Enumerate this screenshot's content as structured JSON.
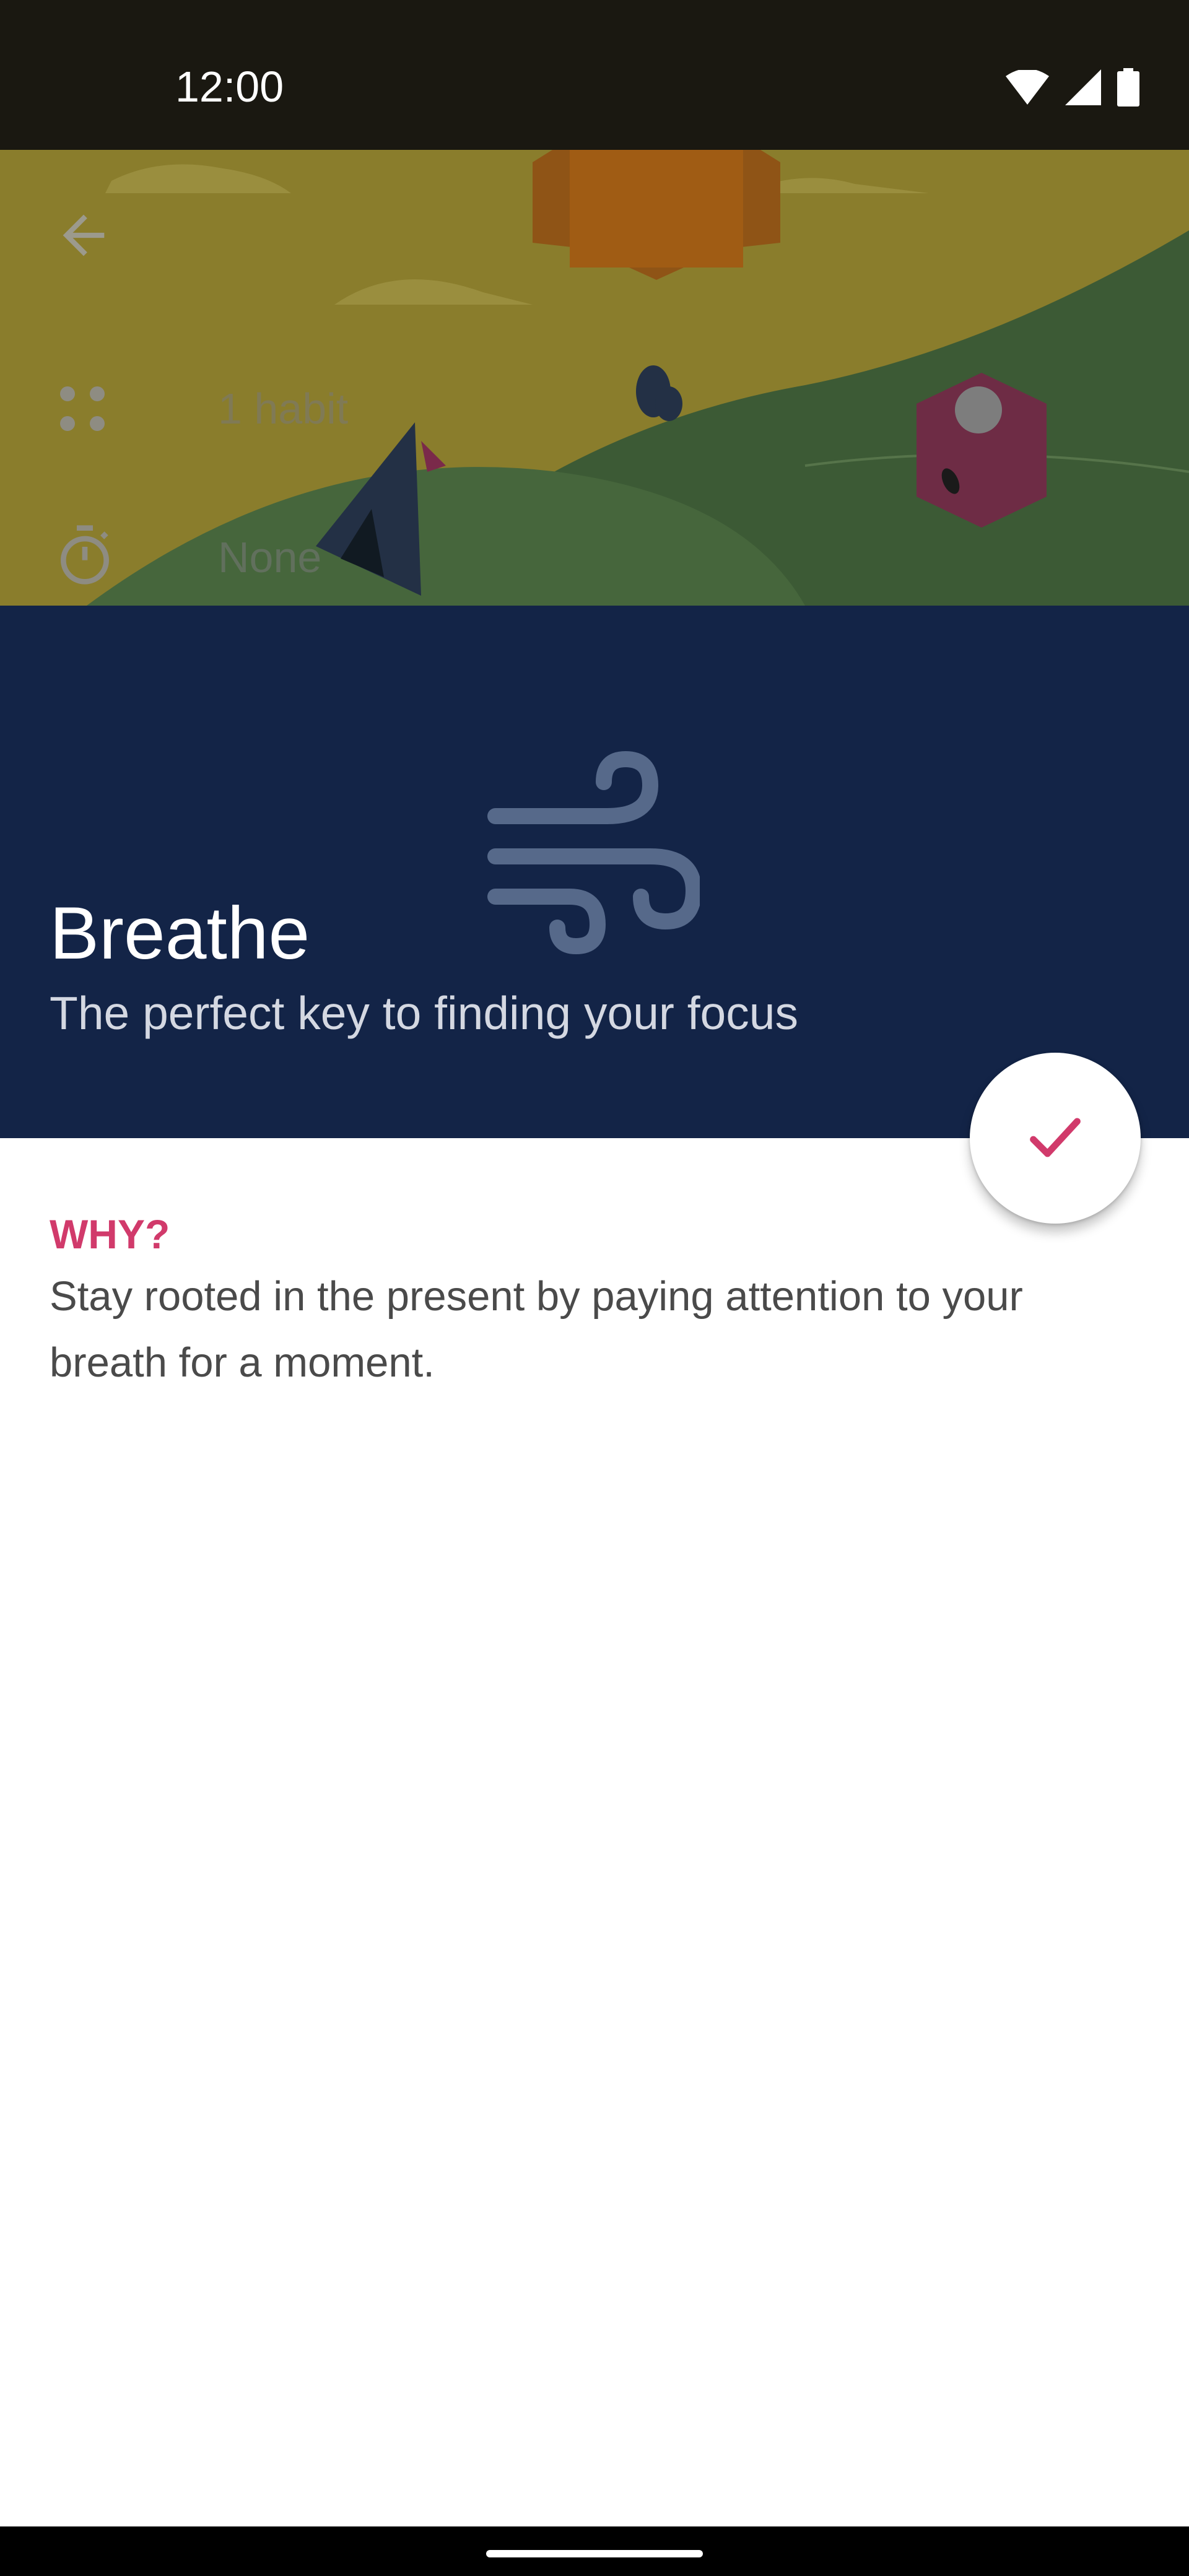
{
  "status_bar": {
    "time": "12:00",
    "icons": [
      "wifi-icon",
      "cell-signal-icon",
      "battery-icon"
    ]
  },
  "habit_info": {
    "habit_count": "1 habit",
    "timer_value": "None"
  },
  "header": {
    "title": "Breathe",
    "subtitle": "The perfect key to finding your focus",
    "icon": "wind-icon",
    "background_color": "#132447"
  },
  "why_section": {
    "heading": "WHY?",
    "body": "Stay rooted in the present by paying attention to your breath for a moment."
  },
  "fab": {
    "icon": "check-icon",
    "accent_color": "#d13a6b"
  }
}
